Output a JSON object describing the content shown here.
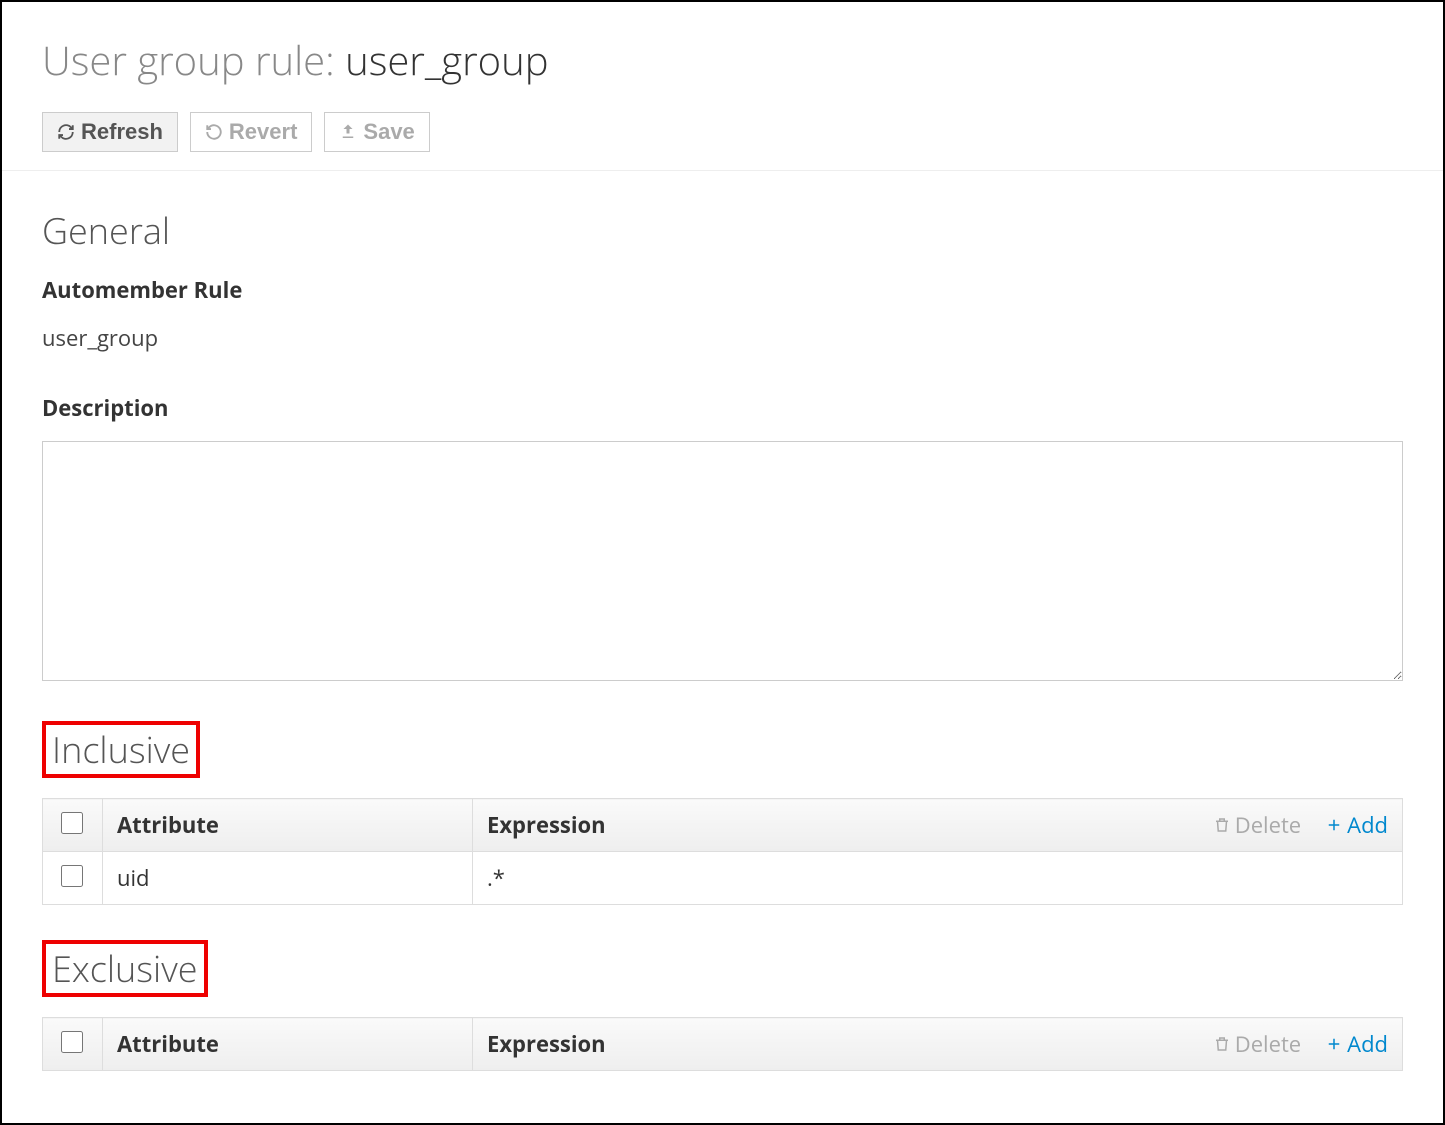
{
  "page": {
    "title_prefix": "User group rule: ",
    "title_name": "user_group"
  },
  "toolbar": {
    "refresh": "Refresh",
    "revert": "Revert",
    "save": "Save"
  },
  "general": {
    "heading": "General",
    "automember_label": "Automember Rule",
    "automember_value": "user_group",
    "description_label": "Description",
    "description_value": ""
  },
  "inclusive": {
    "heading": "Inclusive",
    "columns": {
      "attribute": "Attribute",
      "expression": "Expression"
    },
    "actions": {
      "delete": "Delete",
      "add": "Add"
    },
    "rows": [
      {
        "attribute": "uid",
        "expression": ".*"
      }
    ]
  },
  "exclusive": {
    "heading": "Exclusive",
    "columns": {
      "attribute": "Attribute",
      "expression": "Expression"
    },
    "actions": {
      "delete": "Delete",
      "add": "Add"
    },
    "rows": []
  }
}
